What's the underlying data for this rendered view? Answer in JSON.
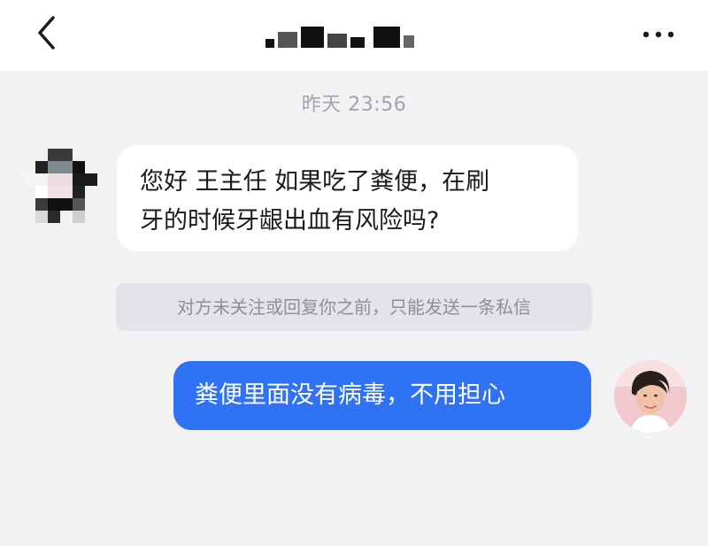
{
  "header": {
    "back_icon": "chevron-left-icon",
    "more_icon": "ellipsis-icon"
  },
  "chat": {
    "timestamp": "昨天 23:56",
    "messages": [
      {
        "direction": "incoming",
        "lines": [
          "您好 王主任 如果吃了粪便，在刷",
          "牙的时候牙龈出血有风险吗?"
        ]
      },
      {
        "direction": "system",
        "text": "对方未关注或回复你之前，只能发送一条私信"
      },
      {
        "direction": "outgoing",
        "text": "粪便里面没有病毒，不用担心"
      }
    ]
  },
  "colors": {
    "background": "#f2f2f5",
    "header_bg": "#ffffff",
    "outgoing_bubble": "#2f72f5",
    "incoming_bubble": "#ffffff",
    "system_note_bg": "#e4e4e8",
    "timestamp_text": "#a3a3aa"
  }
}
